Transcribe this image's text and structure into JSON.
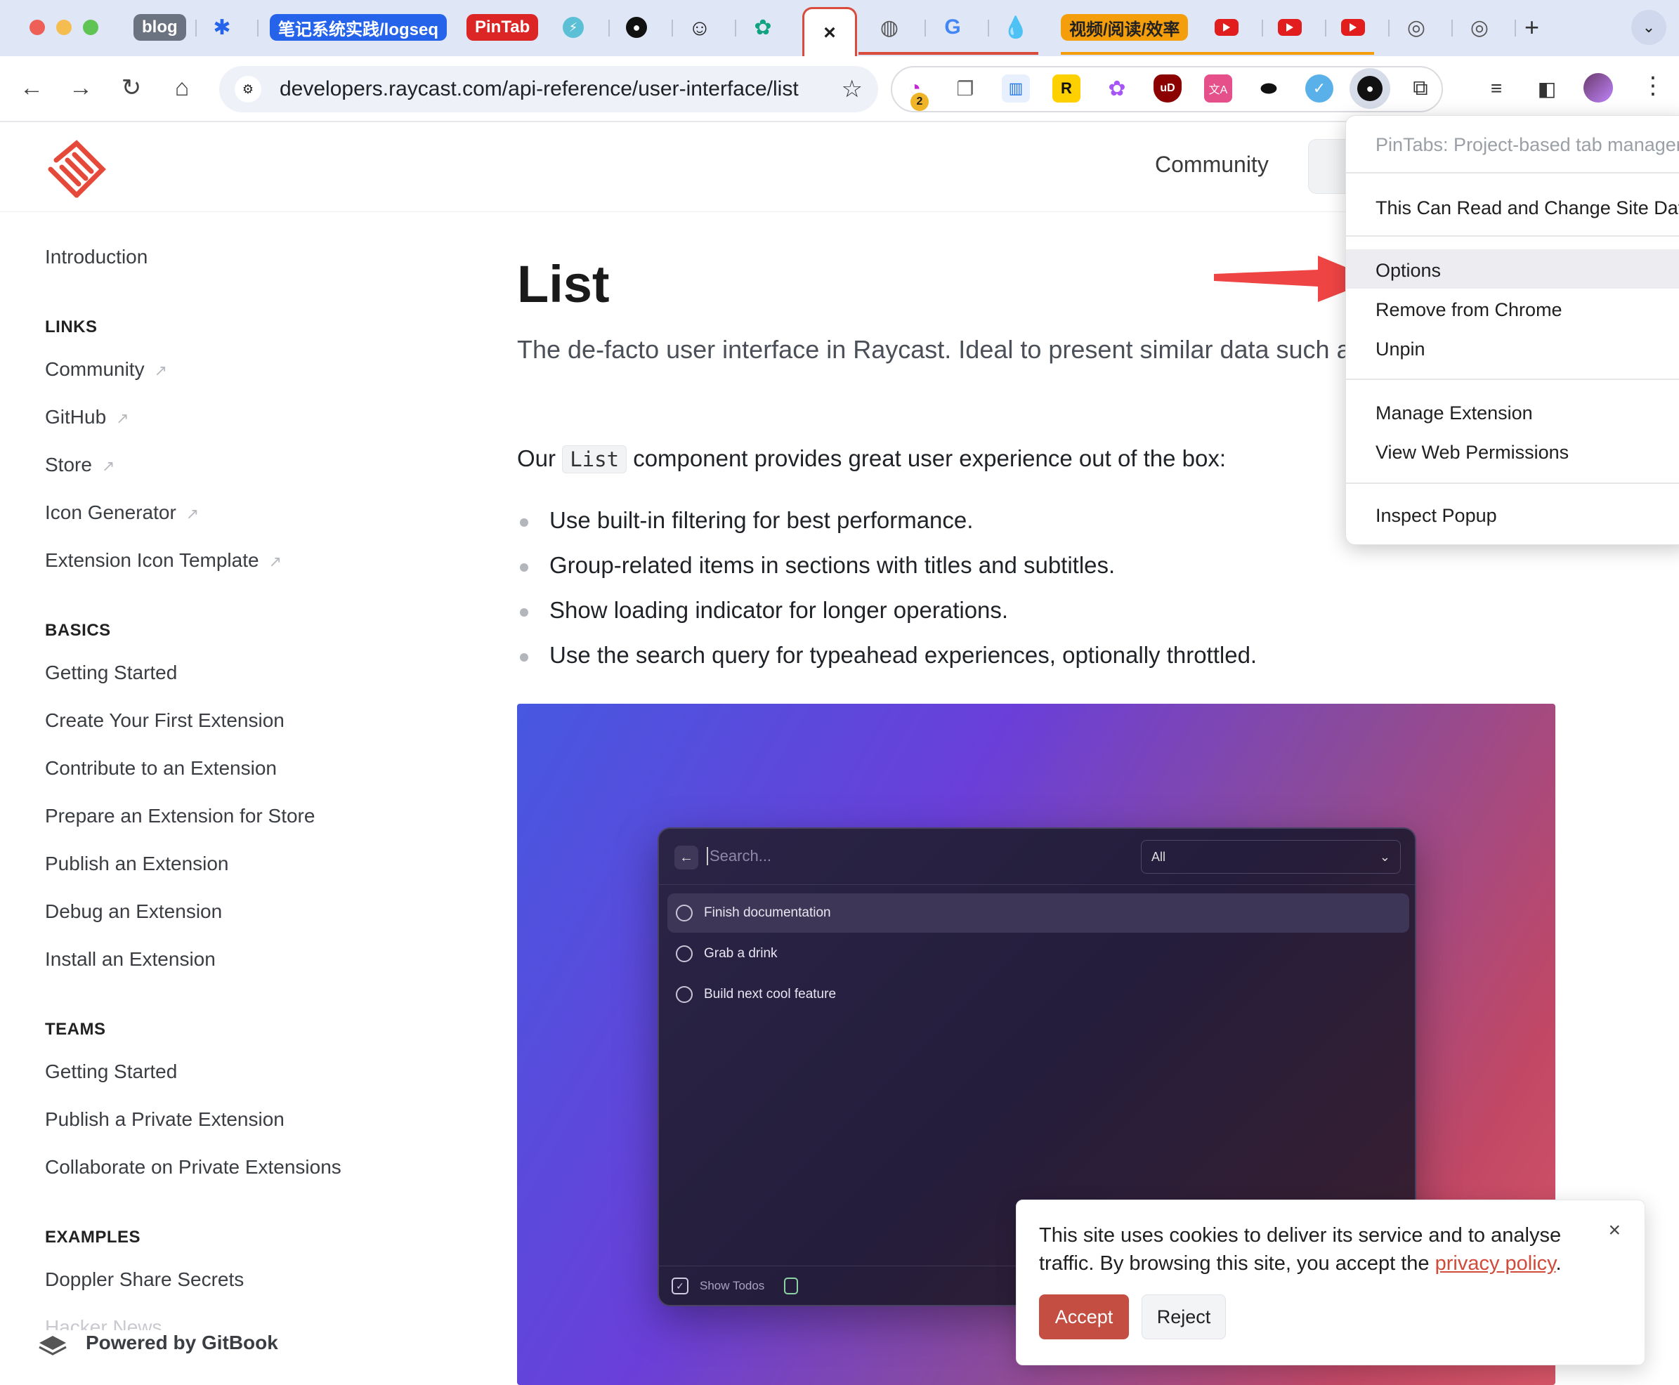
{
  "browser": {
    "tabs": {
      "blog": "blog",
      "logseq": "笔记系统实践/logseq",
      "pintab": "PinTab",
      "video_group": "视频/阅读/效率",
      "active_close": "×"
    },
    "omnibox_url": "developers.raycast.com/api-reference/user-interface/list",
    "extension_badge": "2",
    "new_tab": "+"
  },
  "site": {
    "header_community": "Community"
  },
  "sidebar": {
    "introduction": "Introduction",
    "links_heading": "LINKS",
    "links": [
      "Community",
      "GitHub",
      "Store",
      "Icon Generator",
      "Extension Icon Template"
    ],
    "basics_heading": "BASICS",
    "basics": [
      "Getting Started",
      "Create Your First Extension",
      "Contribute to an Extension",
      "Prepare an Extension for Store",
      "Publish an Extension",
      "Debug an Extension",
      "Install an Extension"
    ],
    "teams_heading": "TEAMS",
    "teams": [
      "Getting Started",
      "Publish a Private Extension",
      "Collaborate on Private Extensions"
    ],
    "examples_heading": "EXAMPLES",
    "examples": [
      "Doppler Share Secrets",
      "Hacker News"
    ],
    "powered_by": "Powered by GitBook"
  },
  "content": {
    "title": "List",
    "lede": "The de-facto user interface in Raycast. Ideal to present similar data such as to-dos or files.",
    "para_before": "Our",
    "para_code": "List",
    "para_after": "component provides great user experience out of the box:",
    "bullets": [
      "Use built-in filtering for best performance.",
      "Group-related items in sections with titles and subtitles.",
      "Show loading indicator for longer operations.",
      "Use the search query for typeahead experiences, optionally throttled."
    ]
  },
  "hero_window": {
    "search_placeholder": "Search...",
    "dropdown_value": "All",
    "items": [
      "Finish documentation",
      "Grab a drink",
      "Build next cool feature"
    ],
    "footer_label": "Show Todos"
  },
  "context_menu": {
    "title": "PinTabs: Project-based tab manager",
    "permission": "This Can Read and Change Site Data",
    "options": "Options",
    "remove": "Remove from Chrome",
    "unpin": "Unpin",
    "manage": "Manage Extension",
    "web_permissions": "View Web Permissions",
    "inspect": "Inspect Popup"
  },
  "cookie": {
    "text_before": "This site uses cookies to deliver its service and to analyse traffic. By browsing this site, you accept the",
    "link": "privacy policy",
    "text_after": ".",
    "accept": "Accept",
    "reject": "Reject",
    "close": "×"
  },
  "colors": {
    "accent_red": "#d94b3c",
    "arrow_red": "#ef4444",
    "accept_button": "#c54e43"
  }
}
